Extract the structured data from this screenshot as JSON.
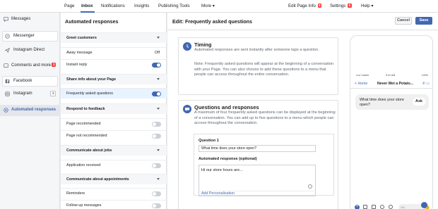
{
  "topnav": {
    "tabs": [
      {
        "label": "Page"
      },
      {
        "label": "Inbox"
      },
      {
        "label": "Notifications"
      },
      {
        "label": "Insights"
      },
      {
        "label": "Publishing Tools"
      },
      {
        "label": "More ▾"
      }
    ],
    "edit_page_info": "Edit Page Info",
    "edit_page_badge": "5",
    "settings": "Settings",
    "settings_badge": "6",
    "help": "Help ▾"
  },
  "sidebar": {
    "items": [
      {
        "label": "Messages",
        "icon": "message-bubble-icon"
      },
      {
        "label": "Messenger",
        "icon": "messenger-icon"
      },
      {
        "label": "Instagram Direct",
        "icon": "instagram-direct-icon"
      },
      {
        "label": "Comments and more",
        "icon": "comments-icon",
        "badge": "3"
      },
      {
        "label": "Facebook",
        "icon": "facebook-icon"
      },
      {
        "label": "Instagram",
        "icon": "instagram-icon",
        "badge": "3"
      },
      {
        "label": "Automated responses",
        "icon": "automated-responses-icon"
      }
    ]
  },
  "automated_responses": {
    "title": "Automated responses",
    "rows": [
      {
        "label": "Greet customers",
        "kind": "section"
      },
      {
        "label": "Away message",
        "kind": "value",
        "value": "Off"
      },
      {
        "label": "Instant reply",
        "kind": "toggle",
        "on": true
      },
      {
        "label": "Share info about your Page",
        "kind": "section"
      },
      {
        "label": "Frequently asked questions",
        "kind": "toggle",
        "on": true,
        "selected": true
      },
      {
        "label": "Respond to feedback",
        "kind": "section"
      },
      {
        "label": "Page recommended",
        "kind": "toggle",
        "on": false
      },
      {
        "label": "Page not recommended",
        "kind": "toggle",
        "on": false
      },
      {
        "label": "Communicate about jobs",
        "kind": "section"
      },
      {
        "label": "Application received",
        "kind": "toggle",
        "on": false
      },
      {
        "label": "Communicate about appointments",
        "kind": "section"
      },
      {
        "label": "Reminders",
        "kind": "toggle",
        "on": false
      },
      {
        "label": "Follow-up messages",
        "kind": "toggle",
        "on": false
      }
    ]
  },
  "edit": {
    "title": "Edit: Frequently asked questions",
    "cancel": "Cancel",
    "save": "Save",
    "timing": {
      "title": "Timing",
      "text1": "Automated responses are sent instantly after someone taps a question.",
      "text2": "Note: Frequently asked questions will appear at the beginning of a conversation with your Page. You can also choose to add these questions to a menu that people can access throughout the entire conversation."
    },
    "qa": {
      "title": "Questions and responses",
      "text": "A maximum of four frequently asked questions can be displayed at the beginning of a conversation. You can add up to five questions to a menu which people can access throughout the conversation.",
      "question_label": "Question 1",
      "question_value": "What time does your store open?",
      "response_label": "Automated response (optional)",
      "response_value": "Hi  our store hours are...",
      "add_personalisation": "Add Personalisation"
    }
  },
  "phone": {
    "carrier": "••••• Carrier",
    "time": "9:41 AM",
    "battery": "100%",
    "back": "< Home",
    "page_name": "Never Met a Potato...",
    "header_icons": "✆ ▭",
    "question": "What time does your store open?",
    "ask": "Ask",
    "input_placeholder": "Aa",
    "like": "👍"
  }
}
